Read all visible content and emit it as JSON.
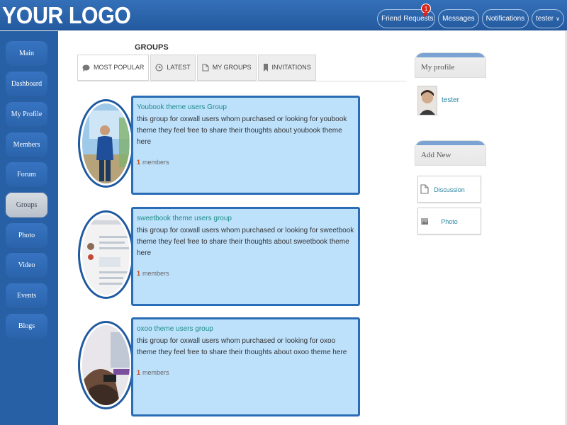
{
  "header": {
    "logo": "YOUR LOGO",
    "nav": [
      {
        "label": "Friend Requests",
        "badge": "1"
      },
      {
        "label": "Messages"
      },
      {
        "label": "Notifications"
      },
      {
        "label": "tester"
      }
    ]
  },
  "sidebar": {
    "items": [
      {
        "label": "Main"
      },
      {
        "label": "Dashboard"
      },
      {
        "label": "My Profile"
      },
      {
        "label": "Members"
      },
      {
        "label": "Forum"
      },
      {
        "label": "Groups",
        "active": true
      },
      {
        "label": "Photo"
      },
      {
        "label": "Video"
      },
      {
        "label": "Events"
      },
      {
        "label": "Blogs"
      }
    ]
  },
  "main": {
    "title": "GROUPS",
    "tabs": [
      {
        "label": "MOST POPULAR",
        "icon": "speech-bubble-icon",
        "active": true
      },
      {
        "label": "LATEST",
        "icon": "clock-icon"
      },
      {
        "label": "MY GROUPS",
        "icon": "document-icon"
      },
      {
        "label": "INVITATIONS",
        "icon": "bookmark-icon"
      }
    ],
    "groups": [
      {
        "title": "Youbook theme users Group",
        "description": "this group for oxwall users whom purchased or looking for youbook theme they feel free to share their thoughts about youbook theme here",
        "count": "1",
        "members_label": "members"
      },
      {
        "title": "sweetbook theme users group",
        "description": "this group for oxwall users whom purchased or looking for sweetbook theme they feel free to share their thoughts about sweetbook theme here",
        "count": "1",
        "members_label": "members"
      },
      {
        "title": "oxoo theme users group",
        "description": "this group for oxwall users whom purchased or looking for oxoo theme they feel free to share their thoughts about oxoo theme here",
        "count": "1",
        "members_label": "members"
      }
    ]
  },
  "right": {
    "profile": {
      "heading": "My profile",
      "username": "tester"
    },
    "add_new": {
      "heading": "Add New",
      "buttons": [
        {
          "label": "Discussion",
          "icon": "document-icon"
        },
        {
          "label": "Photo",
          "icon": "photo-icon"
        }
      ]
    }
  },
  "colors": {
    "header": "#2a63aa",
    "sidebar": "#2860a6",
    "card": "#bde0fb",
    "card_border": "#2a6cb5",
    "link": "#1d8e86",
    "badge": "#d9261c"
  }
}
